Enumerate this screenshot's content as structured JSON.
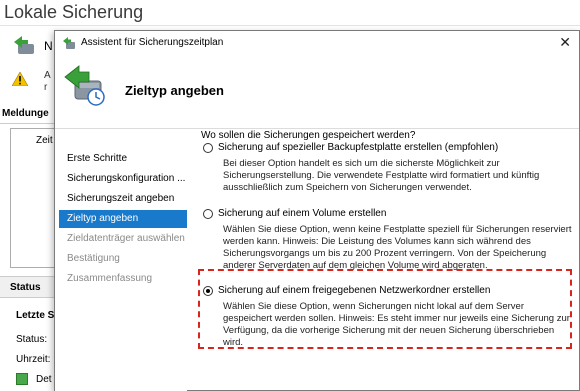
{
  "background": {
    "title": "Lokale Sicherung",
    "n_label": "N",
    "alert_lines": [
      "A",
      "r"
    ],
    "messages_label": "Meldunge",
    "time_col": "Zeit",
    "status_label": "Status",
    "last_label": "Letzte S",
    "status_line": "Status:",
    "time_line": "Uhrzeit:",
    "details_label": "Det"
  },
  "dialog": {
    "title": "Assistent für Sicherungszeitplan",
    "close_glyph": "✕",
    "heading": "Zieltyp angeben",
    "steps": [
      {
        "label": "Erste Schritte",
        "state": "done"
      },
      {
        "label": "Sicherungskonfiguration ...",
        "state": "done"
      },
      {
        "label": "Sicherungszeit angeben",
        "state": "done"
      },
      {
        "label": "Zieltyp angeben",
        "state": "current"
      },
      {
        "label": "Zieldatenträger auswählen",
        "state": "pending"
      },
      {
        "label": "Bestätigung",
        "state": "pending"
      },
      {
        "label": "Zusammenfassung",
        "state": "pending"
      }
    ],
    "question": "Wo sollen die Sicherungen gespeichert werden?",
    "options": [
      {
        "label": "Sicherung auf spezieller Backupfestplatte erstellen (empfohlen)",
        "selected": false,
        "description": "Bei dieser Option handelt es sich um die sicherste Möglichkeit zur Sicherungserstellung. Die verwendete Festplatte wird formatiert und künftig ausschließlich zum Speichern von Sicherungen verwendet."
      },
      {
        "label": "Sicherung auf einem Volume erstellen",
        "selected": false,
        "description": "Wählen Sie diese Option, wenn keine Festplatte speziell für Sicherungen reserviert werden kann. Hinweis: Die Leistung des Volumes kann sich während des Sicherungsvorgangs um bis zu 200 Prozent verringern. Von der Speicherung anderer Serverdaten auf dem gleichen Volume wird abgeraten."
      },
      {
        "label": "Sicherung auf einem freigegebenen Netzwerkordner erstellen",
        "selected": true,
        "description": "Wählen Sie diese Option, wenn Sicherungen nicht lokal auf dem Server gespeichert werden sollen. Hinweis: Es steht immer nur jeweils eine Sicherung zur Verfügung, da die vorherige Sicherung mit der neuen Sicherung überschrieben wird."
      }
    ]
  },
  "colors": {
    "selection": "#1979ca",
    "highlight_border": "#d9261c"
  }
}
